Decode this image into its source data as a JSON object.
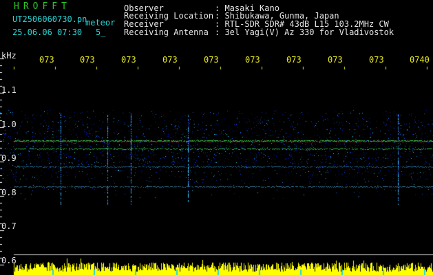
{
  "header": {
    "app_name": "HROFFT",
    "file_name": "UT2506060730.pn",
    "mode": "meteor",
    "datetime": "25.06.06 07:30",
    "count": "5_",
    "observer_label": "Observer",
    "observer_value": ": Masaki Kano",
    "location_label": "Receiving Location",
    "location_value": ": Shibukawa, Gunma, Japan",
    "receiver_label": "Receiver",
    "receiver_value": ": RTL-SDR SDR# 43dB L15 103.2MHz CW",
    "antenna_label": "Receiving Antenna",
    "antenna_value": ": 3el Yagi(V) Az 330 for Vladivostok"
  },
  "yaxis": {
    "unit": "kHz",
    "ticks": [
      "1.1",
      "1.0",
      "0.9",
      "0.8",
      "0.7",
      "0.6"
    ]
  },
  "xaxis": {
    "ticks": [
      "073",
      "073",
      "073",
      "073",
      "073",
      "073",
      "073",
      "073",
      "073",
      "0740"
    ]
  },
  "colors": {
    "label_cyan": "#27d7d7",
    "label_green": "#26c826",
    "label_yellow": "#e8e81c",
    "noise_blue": "#1a3ce0",
    "echo_line_red": "#ff3030",
    "echo_line_green": "#40ff60",
    "level_bar_yellow": "#ffff00"
  }
}
